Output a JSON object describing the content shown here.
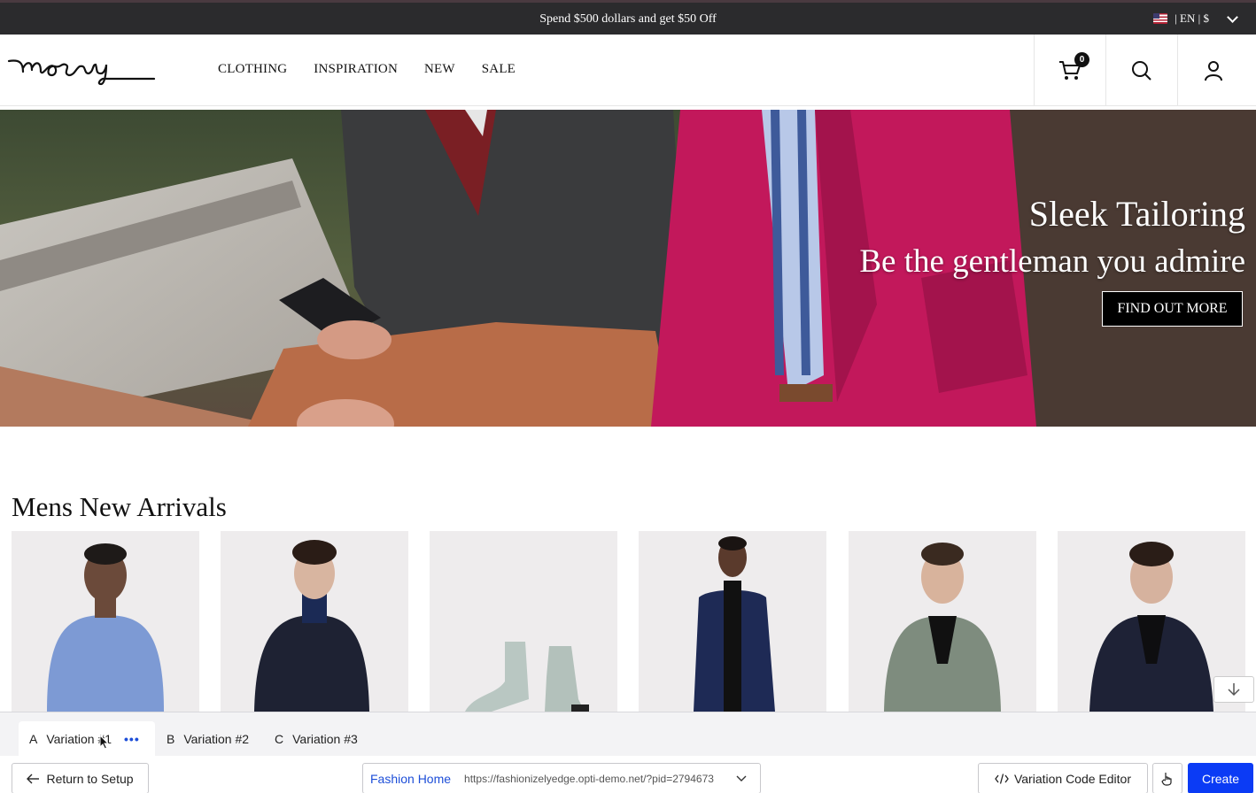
{
  "promo": {
    "text": "Spend $500 dollars and get $50 Off",
    "locale": "| EN | $",
    "flag_icon": "us-flag-icon"
  },
  "header": {
    "logo_text": "mosey",
    "nav": [
      "CLOTHING",
      "INSPIRATION",
      "NEW",
      "SALE"
    ],
    "cart_count": "0",
    "icons": [
      "cart-icon",
      "search-icon",
      "account-icon"
    ]
  },
  "hero": {
    "title": "Sleek Tailoring",
    "subtitle": "Be the gentleman you admire",
    "button": "FIND OUT MORE"
  },
  "arrivals": {
    "title": "Mens New Arrivals",
    "products": [
      "blue sweater",
      "navy coat turtleneck",
      "grey boots",
      "navy long coat",
      "green blazer",
      "navy blazer"
    ]
  },
  "editor": {
    "tabs": [
      {
        "letter": "A",
        "label": "Variation #1"
      },
      {
        "letter": "B",
        "label": "Variation #2"
      },
      {
        "letter": "C",
        "label": "Variation #3"
      }
    ],
    "return_label": "Return to Setup",
    "page_name": "Fashion Home",
    "url": "https://fashionizelyedge.opti-demo.net/?pid=2794673",
    "code_editor_label": "Variation Code Editor",
    "create_label": "Create"
  },
  "colors": {
    "promo_bg": "#2b2b2d",
    "accent_blue": "#0b3bf5",
    "link_blue": "#1d4ed8",
    "hero_magenta": "#c2185b"
  }
}
